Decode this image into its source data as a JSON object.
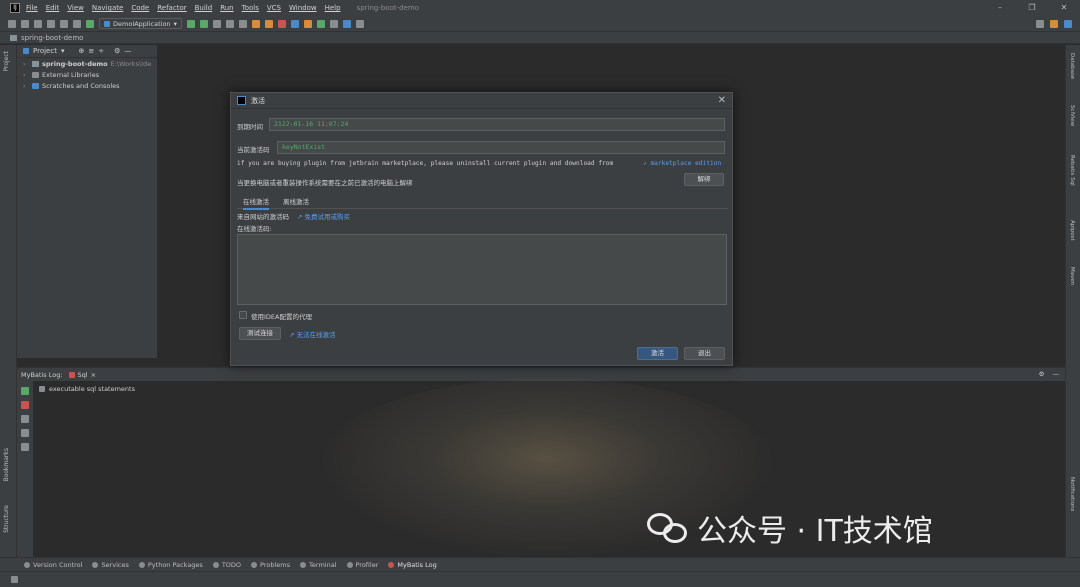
{
  "titlebar": {
    "menu": [
      "File",
      "Edit",
      "View",
      "Navigate",
      "Code",
      "Refactor",
      "Build",
      "Run",
      "Tools",
      "VCS",
      "Window",
      "Help"
    ],
    "project_title": "spring-boot-demo"
  },
  "toolbar": {
    "run_config": "DemoIApplication"
  },
  "navbar": {
    "breadcrumb": "spring-boot-demo"
  },
  "left_stripe": {
    "project": "Project",
    "bookmarks": "Bookmarks",
    "structure": "Structure"
  },
  "project_panel": {
    "title": "Project",
    "items": [
      {
        "label": "spring-boot-demo",
        "path": "E:\\Works\\Ide"
      },
      {
        "label": "External Libraries",
        "path": ""
      },
      {
        "label": "Scratches and Consoles",
        "path": ""
      }
    ]
  },
  "right_stripe": {
    "tabs": [
      "Database",
      "SciView",
      "Rebatis Sql",
      "Apipost",
      "Maven",
      "Notifications"
    ]
  },
  "bottom_panel": {
    "title": "MyBatis Log:",
    "tab": "Sql",
    "content": "executable sql statements"
  },
  "watermark": {
    "text": "公众号 · IT技术馆"
  },
  "bottom_tabs": [
    "Version Control",
    "Services",
    "Python Packages",
    "TODO",
    "Problems",
    "Terminal",
    "Profiler",
    "MyBatis Log"
  ],
  "dialog": {
    "title": "激活",
    "expire_label": "到期时间",
    "expire_value": "2122-01-16 11:07:24",
    "code_label": "当前激活码",
    "code_value": "keyNotExist",
    "notice": "if you are buying plugin from jetbrain marketplace, please uninstall current plugin and download from",
    "notice_link": "marketplace edition",
    "unbind_text": "当更换电脑或者重装操作系统需要在之前已激活的电脑上解绑",
    "unbind_button": "解绑",
    "tab_online": "在线激活",
    "tab_offline": "离线激活",
    "source_label": "来自网站的激活码",
    "source_link": "免费试用或购买",
    "online_code_label": "在线激活码:",
    "proxy_label": "使用IDEA配置的代理",
    "test_button": "测试连接",
    "cannot_link": "无法在线激活",
    "activate_button": "激活",
    "exit_button": "退出"
  }
}
